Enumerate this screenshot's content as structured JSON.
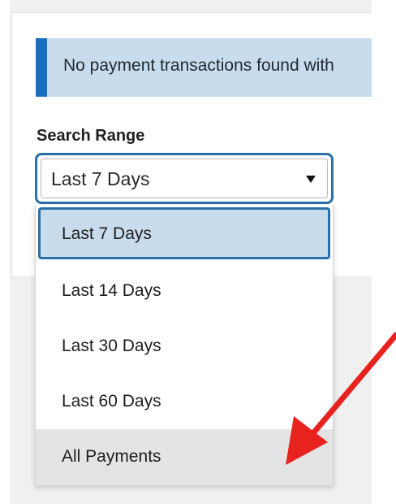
{
  "alert": {
    "message": "No payment transactions found with"
  },
  "search_range": {
    "label": "Search Range",
    "selected_value": "Last 7 Days",
    "options": [
      {
        "label": "Last 7 Days",
        "selected": true
      },
      {
        "label": "Last 14 Days",
        "selected": false
      },
      {
        "label": "Last 30 Days",
        "selected": false
      },
      {
        "label": "Last 60 Days",
        "selected": false
      },
      {
        "label": "All Payments",
        "selected": false,
        "hovered": true
      }
    ]
  },
  "annotation": {
    "arrow_color": "#e8231f",
    "points_to": "All Payments"
  },
  "colors": {
    "accent": "#1b6ec2",
    "focus_border": "#2a6fa8",
    "alert_bg": "#c8dcee",
    "hover_bg": "#e4e4e4"
  }
}
